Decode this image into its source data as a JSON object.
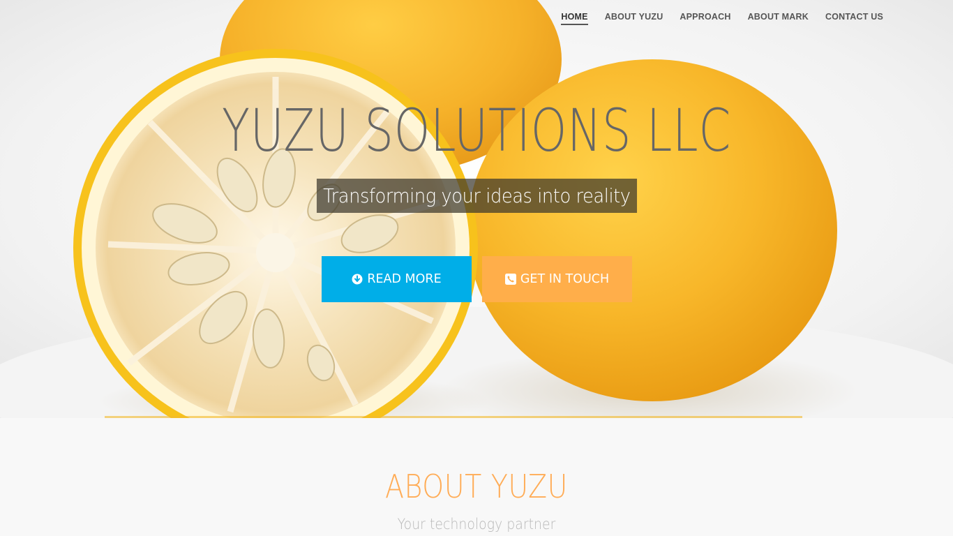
{
  "nav": {
    "items": [
      {
        "label": "HOME",
        "active": true
      },
      {
        "label": "ABOUT YUZU",
        "active": false
      },
      {
        "label": "APPROACH",
        "active": false
      },
      {
        "label": "ABOUT MARK",
        "active": false
      },
      {
        "label": "CONTACT US",
        "active": false
      }
    ]
  },
  "hero": {
    "title": "YUZU SOLUTIONS LLC",
    "tagline": "Transforming your ideas into reality",
    "background_image": "halved-and-whole-yuzu-citrus-photo",
    "buttons": {
      "read_more": {
        "label": "READ MORE",
        "icon": "arrow-circle-down-icon",
        "color": "#00aee8"
      },
      "get_in_touch": {
        "label": "GET IN TOUCH",
        "icon": "phone-square-icon",
        "color": "#ffae4a"
      }
    }
  },
  "about": {
    "title": "ABOUT YUZU",
    "subtitle": "Your technology partner",
    "title_color": "#ffac56"
  }
}
